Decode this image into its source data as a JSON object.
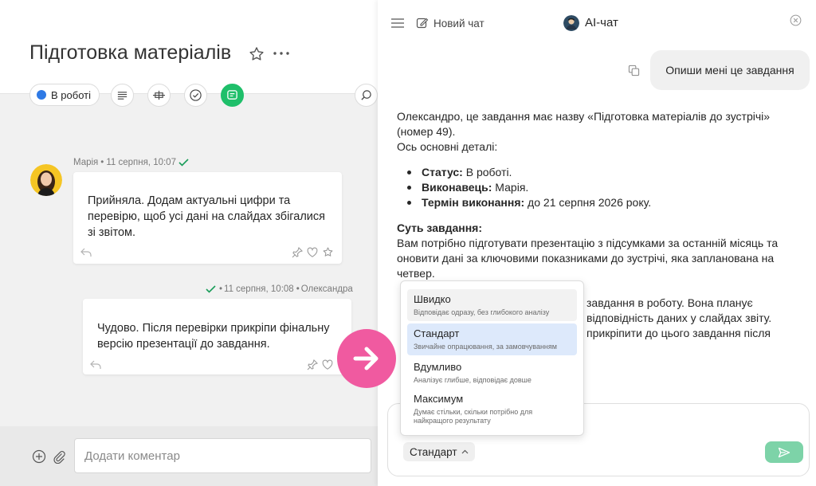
{
  "task": {
    "title": "Підготовка матеріалів",
    "status_label": "В роботі",
    "status_color": "#2f7ae5",
    "icons": [
      "star-icon",
      "more-icon",
      "description-icon",
      "checklist-icon",
      "done-icon",
      "comments-icon",
      "search-icon"
    ]
  },
  "comments": [
    {
      "author": "Марія",
      "sep": "•",
      "time": "11 серпня, 10:07",
      "text": "Прийняла. Додам актуальні цифри та перевірю, щоб усі дані на слайдах збігалися зі звітом."
    },
    {
      "author": "Олександра",
      "sep": "•",
      "time": "11 серпня, 10:08",
      "text": "Чудово. Після перевірки прикріпи фінальну версію презентації до завдання."
    }
  ],
  "comment_input": {
    "placeholder": "Додати коментар",
    "value": ""
  },
  "chat": {
    "new_chat_label": "Новий чат",
    "title": "AI-чат",
    "user_message": "Опиши мені це завдання",
    "answer": {
      "intro_1": "Олександро, це завдання має назву «Підготовка матеріалів до зустрічі» (номер 49).",
      "intro_2": "Ось основні деталі:",
      "details": [
        {
          "label": "Статус:",
          "value": " В роботі."
        },
        {
          "label": "Виконавець:",
          "value": " Марія."
        },
        {
          "label": "Термін виконання:",
          "value": " до 21 серпня 2026 року."
        }
      ],
      "essence_title": "Суть завдання:",
      "essence_text": "Вам потрібно підготувати презентацію з підсумками за останній місяць та оновити дані за ключовими показниками до зустрічі, яка запланована на четвер.",
      "hidden_line_1": "завдання в роботу. Вона планує",
      "hidden_line_2": "відповідність даних у слайдах звіту.",
      "hidden_line_3": "прикріпити до цього завдання після"
    },
    "mode_selected": "Стандарт",
    "mode_options": [
      {
        "title": "Швидко",
        "desc": "Відповідає одразу, без глибокого аналізу"
      },
      {
        "title": "Стандарт",
        "desc": "Звичайне опрацювання, за замовчуванням"
      },
      {
        "title": "Вдумливо",
        "desc": "Аналізує глибше, відповідає довше"
      },
      {
        "title": "Максимум",
        "desc": "Думає стільки, скільки потрібно для найкращого результату"
      }
    ],
    "colors": {
      "send": "#7dd3a8",
      "selected_option": "#dde9fb",
      "accent_green": "#1fbf6a",
      "arrow_badge": "#f05aa0"
    }
  }
}
